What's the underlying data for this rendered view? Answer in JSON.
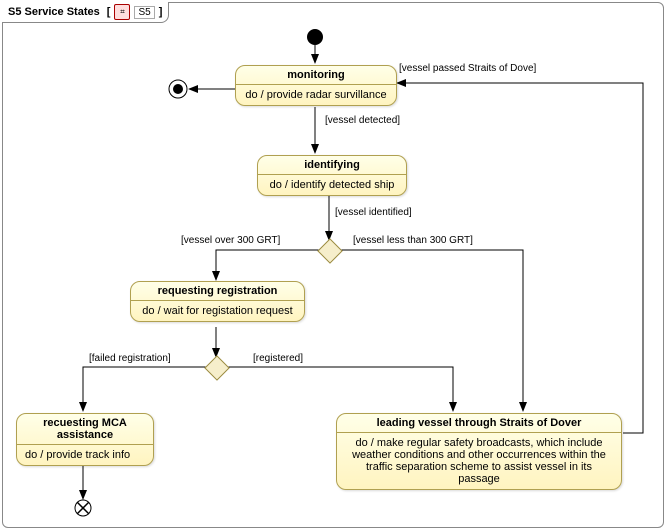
{
  "frame": {
    "title": "S5 Service States",
    "ref": "S5"
  },
  "states": {
    "monitoring": {
      "name": "monitoring",
      "activity": "do / provide radar survillance"
    },
    "identifying": {
      "name": "identifying",
      "activity": "do / identify detected ship"
    },
    "requesting_registration": {
      "name": "requesting registration",
      "activity": "do / wait for registation request"
    },
    "requesting_mca": {
      "name": "recuesting MCA assistance",
      "activity": "do / provide track info"
    },
    "leading": {
      "name": "leading vessel through Straits of Dover",
      "activity": "do / make regular safety broadcasts, which include weather conditions and other occurrences within the traffic separation scheme to assist vessel in its passage"
    }
  },
  "transitions": {
    "vessel_detected": "[vessel detected]",
    "vessel_identified": "[vessel identified]",
    "over_300": "[vessel over 300 GRT]",
    "less_300": "[vessel less than 300 GRT]",
    "failed_reg": "[failed registration]",
    "registered": "[registered]",
    "passed_straits": "[vessel passed Straits of Dove]"
  },
  "chart_data": {
    "type": "state_machine",
    "initial": "initial",
    "final": "final",
    "terminate": "terminate",
    "states": [
      "monitoring",
      "identifying",
      "requesting registration",
      "recuesting MCA assistance",
      "leading vessel through Straits of Dover"
    ],
    "transitions": [
      {
        "from": "initial",
        "to": "monitoring",
        "guard": null
      },
      {
        "from": "monitoring",
        "to": "final",
        "guard": null
      },
      {
        "from": "monitoring",
        "to": "identifying",
        "guard": "vessel detected"
      },
      {
        "from": "identifying",
        "to": "choice1",
        "guard": "vessel identified"
      },
      {
        "from": "choice1",
        "to": "requesting registration",
        "guard": "vessel over 300 GRT"
      },
      {
        "from": "choice1",
        "to": "leading vessel through Straits of Dover",
        "guard": "vessel less than 300 GRT"
      },
      {
        "from": "requesting registration",
        "to": "choice2",
        "guard": null
      },
      {
        "from": "choice2",
        "to": "recuesting MCA assistance",
        "guard": "failed registration"
      },
      {
        "from": "choice2",
        "to": "leading vessel through Straits of Dover",
        "guard": "registered"
      },
      {
        "from": "recuesting MCA assistance",
        "to": "terminate",
        "guard": null
      },
      {
        "from": "leading vessel through Straits of Dover",
        "to": "monitoring",
        "guard": "vessel passed Straits of Dove"
      }
    ]
  }
}
